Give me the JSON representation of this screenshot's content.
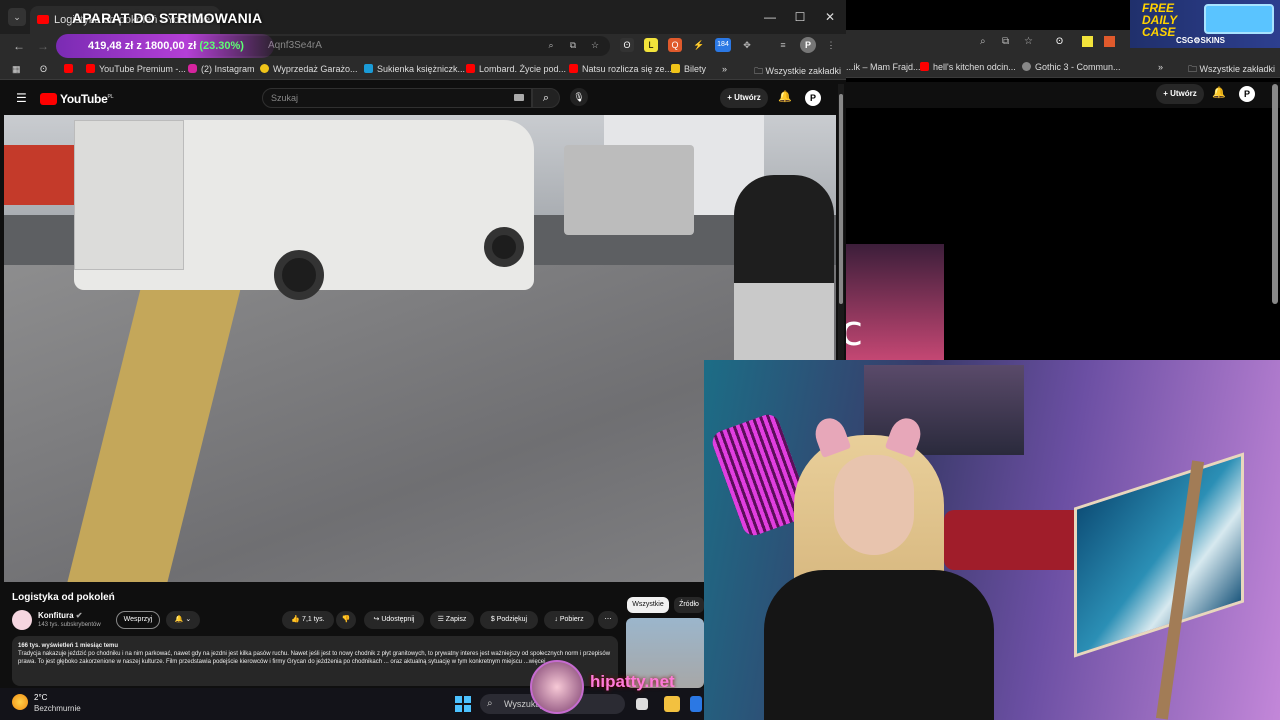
{
  "browser": {
    "tab_title": "Logistyka od pokoleń - YouTube",
    "overlay_title": "APARAT DO STRIMOWANIA",
    "price": "419,48 zł",
    "price_goal": "z 1800,00 zł",
    "price_pct": "(23.30%)",
    "url_fragment": "Aqnf3Se4rA",
    "bookmarks": [
      "YouTube Premium -...",
      "(2) Instagram",
      "Wyprzedaż Garażo...",
      "Sukienka księżniczk...",
      "Lombard. Życie pod...",
      "Natsu rozlicza się ze...",
      "Bilety",
      "Wszystkie zakładki"
    ],
    "ext_badge": "184"
  },
  "youtube": {
    "logo": "YouTube",
    "logo_region": "PL",
    "search_placeholder": "Szukaj",
    "create_label": "Utwórz",
    "avatar_letter": "P",
    "video_title": "Logistyka od pokoleń",
    "channel_name": "Konfitura",
    "channel_subs": "143 tys. subskrybentów",
    "support_label": "Wesprzyj",
    "likes": "7,1 tys.",
    "share_label": "Udostępnij",
    "save_label": "Zapisz",
    "thanks_label": "Podziękuj",
    "download_label": "Pobierz",
    "views_meta": "166 tys. wyświetleń  1 miesiąc temu",
    "description": "Tradycja nakazuje jeździć po chodniku i na nim parkować, nawet gdy na jezdni jest kilka pasów ruchu. Nawet jeśli jest to nowy chodnik z płyt granitowych, to prywatny interes jest ważniejszy od społecznych norm i przepisów prawa. To jest głęboko zakorzenione w naszej kulturze. Film przedstawia podejście kierowców i firmy Grycan do jeżdżenia po chodnikach ... oraz aktualną sytuację w tym konkretnym miejscu ...więcej",
    "chips": [
      "Wszystkie",
      "Źródło"
    ]
  },
  "second_window": {
    "bookmarks": [
      "...ik – Mam Frajd...",
      "hell's kitchen odcin...",
      "Gothic 3 - Commun...",
      "Wszystkie zakładki"
    ],
    "create_label": "Utwórz",
    "avatar_letter": "P",
    "hits_text": "c hits"
  },
  "ad": {
    "free_line1": "FREE",
    "free_line2": "DAILY",
    "free_line3": "CASE",
    "brand": "CSG⚙SKINS"
  },
  "overlay": {
    "handle": "hipatty.net"
  },
  "taskbar": {
    "temperature": "2°C",
    "weather": "Bezchmurnie",
    "search_placeholder": "Wyszukaj"
  }
}
